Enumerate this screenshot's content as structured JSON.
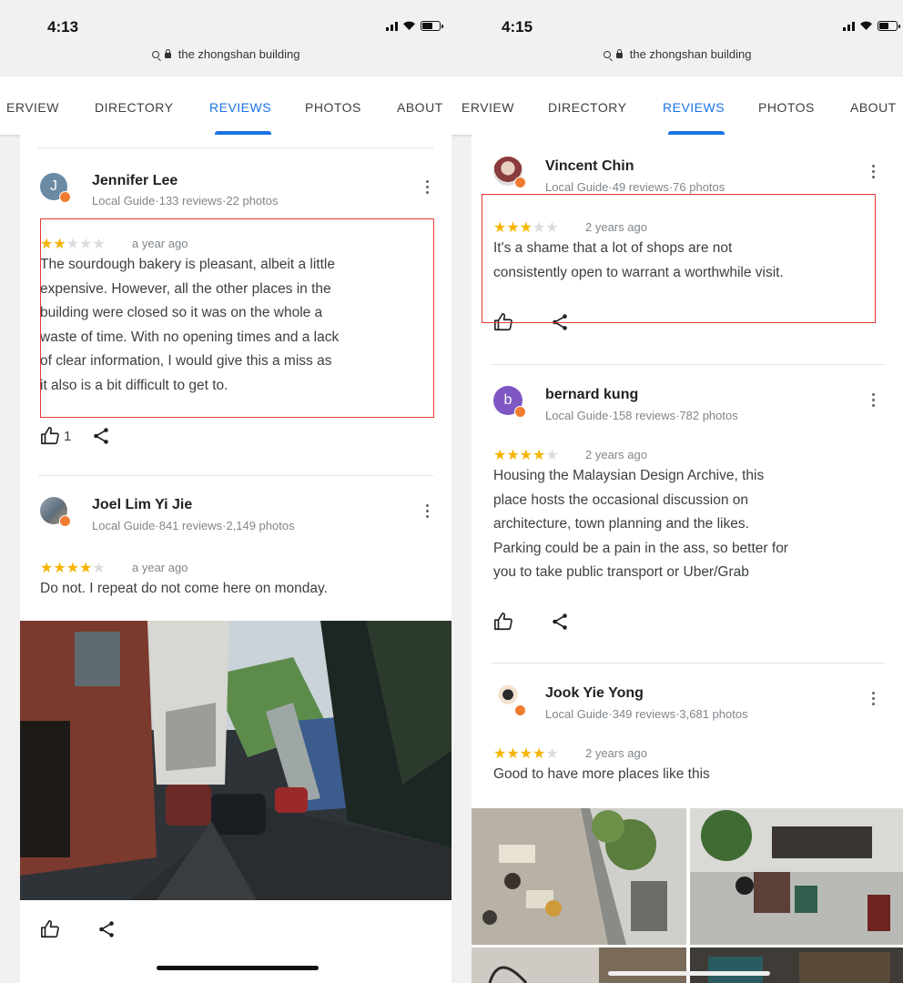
{
  "left": {
    "time": "4:13",
    "url": "the zhongshan building",
    "tabs": [
      {
        "label": "ERVIEW"
      },
      {
        "label": "DIRECTORY"
      },
      {
        "label": "REVIEWS"
      },
      {
        "label": "PHOTOS"
      },
      {
        "label": "ABOUT"
      }
    ],
    "reviews": [
      {
        "name": "Jennifer Lee",
        "initial": "J",
        "avatar_color": "#6b8aa3",
        "meta": "Local Guide·133 reviews·22 photos",
        "stars": 2,
        "ago": "a year ago",
        "lines": [
          "The sourdough bakery is pleasant, albeit a little",
          "expensive. However, all the other places in the",
          "building were closed so it was on the whole a",
          "waste of time. With no opening times and a lack",
          "of clear information, I would give this a miss as",
          "it also is a bit difficult to get to."
        ],
        "likes": "1"
      },
      {
        "name": "Joel Lim Yi Jie",
        "meta": "Local Guide·841 reviews·2,149 photos",
        "stars": 4,
        "ago": "a year ago",
        "text": "Do not. I repeat do not come here on monday."
      }
    ]
  },
  "right": {
    "time": "4:15",
    "url": "the zhongshan building",
    "tabs": [
      {
        "label": "ERVIEW"
      },
      {
        "label": "DIRECTORY"
      },
      {
        "label": "REVIEWS"
      },
      {
        "label": "PHOTOS"
      },
      {
        "label": "ABOUT"
      }
    ],
    "reviews": [
      {
        "name": "Vincent Chin",
        "meta": "Local Guide·49 reviews·76 photos",
        "stars": 3,
        "ago": "2 years ago",
        "lines": [
          "It's a shame that a lot of shops are not",
          "consistently open to warrant a worthwhile visit."
        ]
      },
      {
        "name": "bernard kung",
        "initial": "b",
        "avatar_color": "#7e57c2",
        "meta": "Local Guide·158 reviews·782 photos",
        "stars": 4,
        "ago": "2 years ago",
        "lines": [
          "Housing the Malaysian Design Archive, this",
          "place hosts the occasional discussion on",
          "architecture, town planning and the likes.",
          "Parking could be a pain in the ass, so better for",
          "you to take public transport or Uber/Grab"
        ]
      },
      {
        "name": "Jook Yie Yong",
        "meta": "Local Guide·349 reviews·3,681 photos",
        "stars": 4,
        "ago": "2 years ago",
        "text": "Good to have more places like this"
      }
    ]
  },
  "colors": {
    "accent": "#1a73e8",
    "star": "#f4b400",
    "highlight_box": "#e53935",
    "local_guide_badge": "#f07c32"
  }
}
